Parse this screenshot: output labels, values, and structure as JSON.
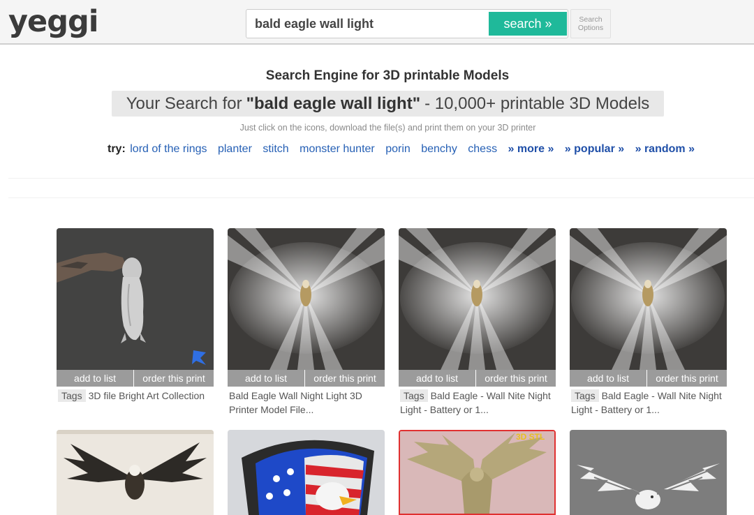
{
  "header": {
    "logo": "yeggi",
    "search_value": "bald eagle wall light",
    "search_button": "search »",
    "options_line1": "Search",
    "options_line2": "Options"
  },
  "main": {
    "engine_title": "Search Engine for 3D printable Models",
    "result_prefix": "Your Search for",
    "result_query": "\"bald eagle wall light\"",
    "result_suffix": "- 10,000+ printable 3D Models",
    "hint": "Just click on the icons, download the file(s) and print them on your 3D printer",
    "try_label": "try:",
    "try_links": [
      "lord of the rings",
      "planter",
      "stitch",
      "monster hunter",
      "porin",
      "benchy",
      "chess"
    ],
    "more_links": [
      "» more »",
      "» popular »",
      "» random »"
    ]
  },
  "cards": [
    {
      "add": "add to list",
      "order": "order this print",
      "tag": "Tags",
      "caption": "3D file Bright Art Collection"
    },
    {
      "add": "add to list",
      "order": "order this print",
      "tag": "",
      "caption": "Bald Eagle Wall Night Light 3D Printer Model File..."
    },
    {
      "add": "add to list",
      "order": "order this print",
      "tag": "Tags",
      "caption": "Bald Eagle - Wall Nite Night Light - Battery or 1..."
    },
    {
      "add": "add to list",
      "order": "order this print",
      "tag": "Tags",
      "caption": "Bald Eagle - Wall Nite Night Light - Battery or 1..."
    }
  ],
  "row2_badge": "3D STL",
  "colors": {
    "accent": "#1fb99a",
    "link": "#2660b5",
    "action_bar": "#9b9b9b"
  }
}
